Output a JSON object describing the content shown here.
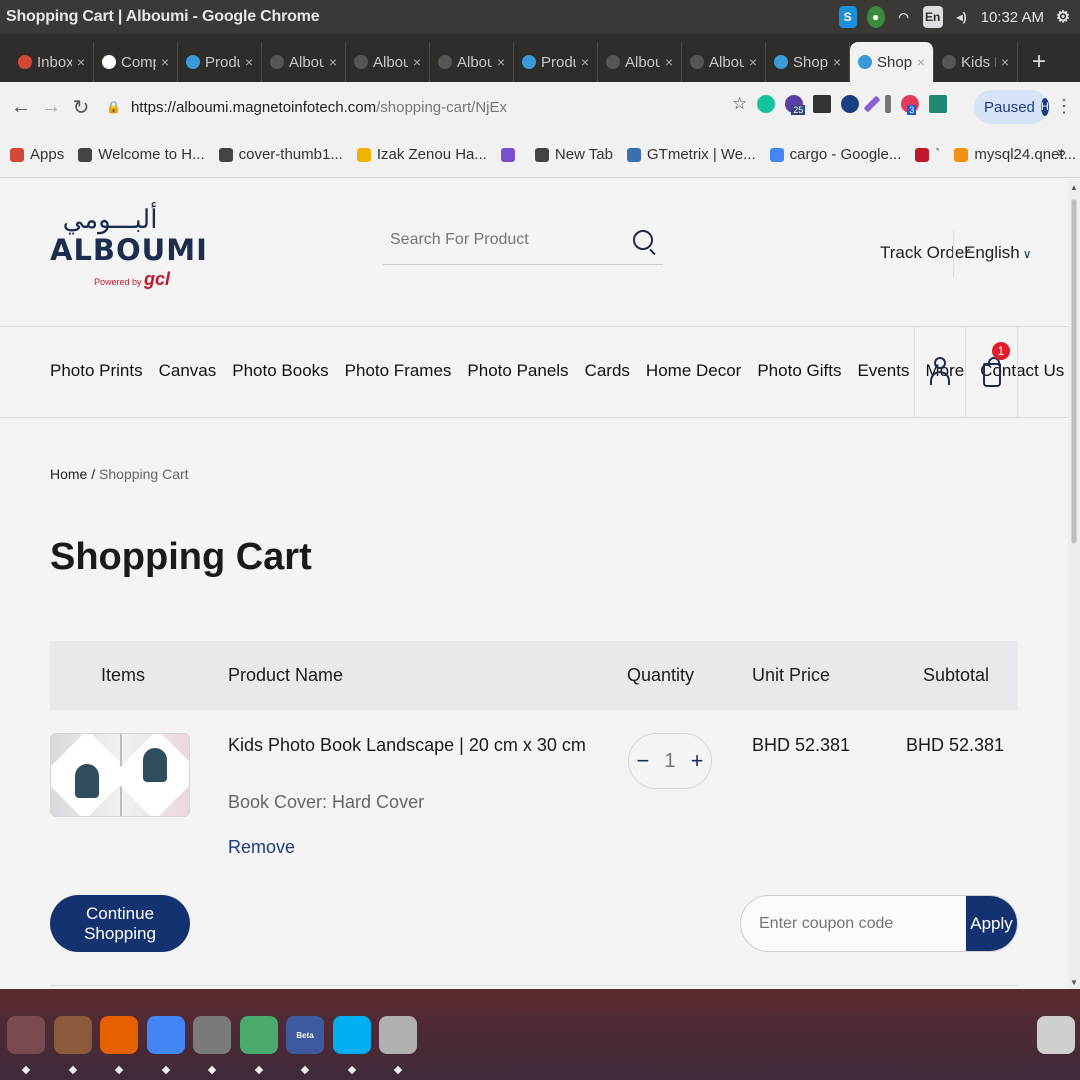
{
  "os": {
    "window_title": "Shopping Cart | Alboumi - Google Chrome",
    "input_indicator": "En",
    "time": "10:32 AM"
  },
  "tabs": [
    {
      "label": "Inbox",
      "color": "#d44638"
    },
    {
      "label": "Comp",
      "color": "#ffffff"
    },
    {
      "label": "Produ",
      "color": "#3b9bd9"
    },
    {
      "label": "Albou",
      "color": "#555555"
    },
    {
      "label": "Albou",
      "color": "#555555"
    },
    {
      "label": "Albou",
      "color": "#555555"
    },
    {
      "label": "Produ",
      "color": "#3b9bd9"
    },
    {
      "label": "Albou",
      "color": "#555555"
    },
    {
      "label": "Albou",
      "color": "#555555"
    },
    {
      "label": "Shopp",
      "color": "#3b9bd9"
    },
    {
      "label": "Shopp",
      "color": "#3b9bd9",
      "active": true
    },
    {
      "label": "Kids P",
      "color": "#555555"
    }
  ],
  "browser": {
    "url_domain": "https://alboumi.magnetoinfotech.com",
    "url_path": "/shopping-cart/NjEx",
    "paused_label": "Paused",
    "profile_initial": "H",
    "ext_badge_1": "25",
    "ext_badge_2": "3"
  },
  "bookmarks": [
    {
      "label": "Apps",
      "icon": "apps-grid-icon",
      "color": "#d44638"
    },
    {
      "label": "Welcome to H...",
      "icon": "globe-icon",
      "color": "#444444"
    },
    {
      "label": "cover-thumb1...",
      "icon": "globe-icon",
      "color": "#444444"
    },
    {
      "label": "Izak Zenou Ha...",
      "icon": "t-icon",
      "color": "#f0b400"
    },
    {
      "label": "",
      "icon": "feather-icon",
      "color": "#7a4fcf"
    },
    {
      "label": "New Tab",
      "icon": "globe-icon",
      "color": "#444444"
    },
    {
      "label": "GTmetrix | We...",
      "icon": "gt-icon",
      "color": "#3a6fb0"
    },
    {
      "label": "cargo - Google...",
      "icon": "google-icon",
      "color": "#4285f4"
    },
    {
      "label": "`",
      "icon": "s-icon",
      "color": "#c0172a"
    },
    {
      "label": "mysql24.qnet...",
      "icon": "pma-icon",
      "color": "#f29111"
    }
  ],
  "site": {
    "logo_arabic": "ألبـــومي",
    "logo_text": "ALBOUMI",
    "logo_powered": "Powered by",
    "logo_brand": "gcl",
    "search_placeholder": "Search For Product",
    "track_order": "Track Order",
    "language": "English",
    "cart_count": "1",
    "nav": [
      "Photo Prints",
      "Canvas",
      "Photo Books",
      "Photo Frames",
      "Photo Panels",
      "Cards",
      "Home Decor",
      "Photo Gifts",
      "Events",
      "More",
      "Contact Us"
    ]
  },
  "cart": {
    "breadcrumb_home": "Home",
    "breadcrumb_sep": " / ",
    "breadcrumb_current": "Shopping Cart",
    "title": "Shopping Cart",
    "headers": {
      "items": "Items",
      "product_name": "Product Name",
      "quantity": "Quantity",
      "unit_price": "Unit Price",
      "subtotal": "Subtotal"
    },
    "item": {
      "name": "Kids Photo Book Landscape | 20 cm x 30 cm",
      "option": "Book Cover: Hard Cover",
      "remove": "Remove",
      "qty": "1",
      "minus": "−",
      "plus": "+",
      "unit_price": "BHD 52.381",
      "subtotal": "BHD 52.381"
    },
    "continue_label": "Continue Shopping",
    "coupon_placeholder": "Enter coupon code",
    "apply_label": "Apply"
  },
  "dock": [
    {
      "name": "ubuntu-icon",
      "color": "#7a4a52"
    },
    {
      "name": "files-icon",
      "color": "#8a5a3a"
    },
    {
      "name": "firefox-icon",
      "color": "#e66000"
    },
    {
      "name": "chrome-icon",
      "color": "#4285f4"
    },
    {
      "name": "settings-icon",
      "color": "#7a7a7a"
    },
    {
      "name": "atom-icon",
      "color": "#4aa96c"
    },
    {
      "name": "chrome-beta-icon",
      "color": "#3d5a9e"
    },
    {
      "name": "skype-icon",
      "color": "#00aff0"
    },
    {
      "name": "camera-icon",
      "color": "#b0b0b0"
    },
    {
      "name": "trash-icon",
      "color": "#cfcfcf"
    }
  ],
  "dock_beta_label": "Beta"
}
